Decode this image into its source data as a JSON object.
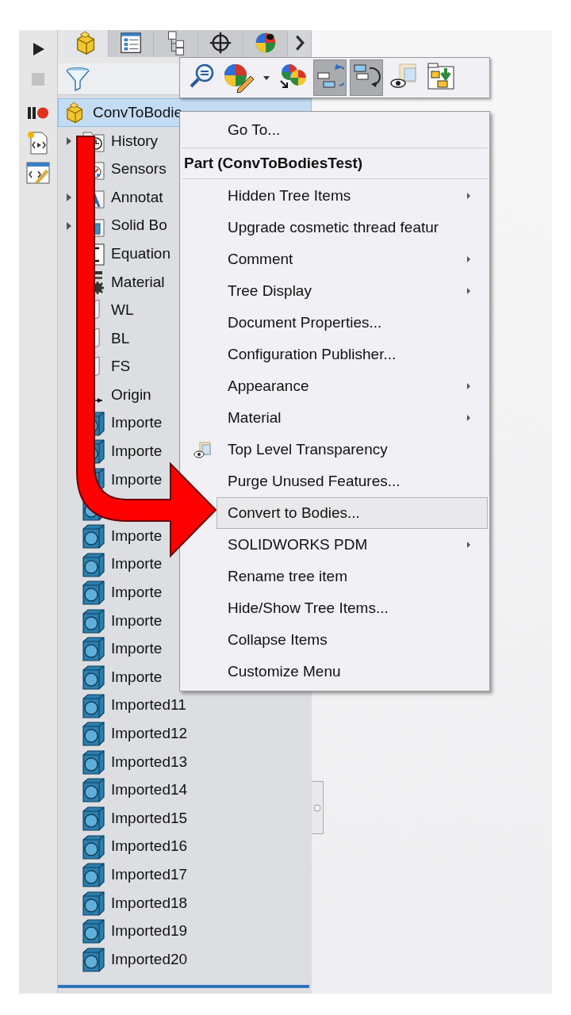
{
  "side_toolbar": [
    {
      "kind": "play",
      "disabled": false
    },
    {
      "kind": "stop",
      "disabled": true
    },
    {
      "kind": "pause_record",
      "disabled": false
    },
    {
      "kind": "macro_file",
      "disabled": false
    },
    {
      "kind": "macro_edit",
      "disabled": false
    }
  ],
  "panel_tabs": [
    {
      "kind": "part",
      "selected": true
    },
    {
      "kind": "properties",
      "selected": false
    },
    {
      "kind": "configurations",
      "selected": false
    },
    {
      "kind": "target",
      "selected": false
    },
    {
      "kind": "appearance",
      "selected": false
    }
  ],
  "tree": {
    "root": {
      "label": "ConvToBodie",
      "selected": true
    },
    "items": [
      {
        "kind": "history",
        "label": "History",
        "expander": true
      },
      {
        "kind": "sensors",
        "label": "Sensors",
        "expander": false
      },
      {
        "kind": "annotations",
        "label": "Annotat",
        "expander": true
      },
      {
        "kind": "solid",
        "label": "Solid Bo",
        "expander": true
      },
      {
        "kind": "equations",
        "label": "Equation",
        "expander": false
      },
      {
        "kind": "material",
        "label": "Material",
        "expander": false
      },
      {
        "kind": "plane",
        "label": "WL",
        "expander": false
      },
      {
        "kind": "plane",
        "label": "BL",
        "expander": false
      },
      {
        "kind": "plane",
        "label": "FS",
        "expander": false
      },
      {
        "kind": "origin",
        "label": "Origin",
        "expander": false
      },
      {
        "kind": "body",
        "label": "Importe",
        "expander": false
      },
      {
        "kind": "body",
        "label": "Importe",
        "expander": false
      },
      {
        "kind": "body",
        "label": "Importe",
        "expander": false
      },
      {
        "kind": "body",
        "expander": false
      },
      {
        "kind": "body",
        "label": "Importe",
        "expander": false
      },
      {
        "kind": "body",
        "label": "Importe",
        "expander": false
      },
      {
        "kind": "body",
        "label": "Importe",
        "expander": false
      },
      {
        "kind": "body",
        "label": "Importe",
        "expander": false
      },
      {
        "kind": "body",
        "label": "Importe",
        "expander": false
      },
      {
        "kind": "body",
        "label": "Importe",
        "expander": false
      },
      {
        "kind": "body",
        "label": "Imported11",
        "expander": false
      },
      {
        "kind": "body",
        "label": "Imported12",
        "expander": false
      },
      {
        "kind": "body",
        "label": "Imported13",
        "expander": false
      },
      {
        "kind": "body",
        "label": "Imported14",
        "expander": false
      },
      {
        "kind": "body",
        "label": "Imported15",
        "expander": false
      },
      {
        "kind": "body",
        "label": "Imported16",
        "expander": false
      },
      {
        "kind": "body",
        "label": "Imported17",
        "expander": false
      },
      {
        "kind": "body",
        "label": "Imported18",
        "expander": false
      },
      {
        "kind": "body",
        "label": "Imported19",
        "expander": false
      },
      {
        "kind": "body",
        "label": "Imported20",
        "expander": false
      }
    ]
  },
  "context_toolbar": {
    "buttons": [
      {
        "kind": "zoom",
        "pressed": false
      },
      {
        "kind": "appearance_edit",
        "pressed": false
      },
      {
        "kind": "dropdown",
        "pressed": false
      },
      {
        "kind": "appearance_copy",
        "pressed": false
      },
      {
        "kind": "tree_rollback",
        "pressed": true
      },
      {
        "kind": "tree_reorder",
        "pressed": true
      },
      {
        "kind": "transparency",
        "pressed": false
      },
      {
        "kind": "folder_swap",
        "pressed": false
      }
    ]
  },
  "context_menu": {
    "items": [
      {
        "kind": "item",
        "label": "Go To...",
        "submenu": false,
        "has_icon": false,
        "selected": false
      },
      {
        "kind": "separator"
      },
      {
        "kind": "header",
        "label": "Part (ConvToBodiesTest)"
      },
      {
        "kind": "separator"
      },
      {
        "kind": "item",
        "label": "Hidden Tree Items",
        "submenu": true,
        "has_icon": false,
        "selected": false
      },
      {
        "kind": "item",
        "label": "Upgrade cosmetic thread featur",
        "submenu": false,
        "has_icon": false,
        "selected": false
      },
      {
        "kind": "item",
        "label": "Comment",
        "submenu": true,
        "has_icon": false,
        "selected": false
      },
      {
        "kind": "item",
        "label": "Tree Display",
        "submenu": true,
        "has_icon": false,
        "selected": false
      },
      {
        "kind": "item",
        "label": "Document Properties...",
        "submenu": false,
        "has_icon": false,
        "selected": false
      },
      {
        "kind": "item",
        "label": "Configuration Publisher...",
        "submenu": false,
        "has_icon": false,
        "selected": false
      },
      {
        "kind": "item",
        "label": "Appearance",
        "submenu": true,
        "has_icon": false,
        "selected": false
      },
      {
        "kind": "item",
        "label": "Material",
        "submenu": true,
        "has_icon": false,
        "selected": false
      },
      {
        "kind": "item",
        "label": "Top Level Transparency",
        "submenu": false,
        "has_icon": true,
        "selected": false
      },
      {
        "kind": "item",
        "label": "Purge Unused Features...",
        "submenu": false,
        "has_icon": false,
        "selected": false
      },
      {
        "kind": "item",
        "label": "Convert to Bodies...",
        "submenu": false,
        "has_icon": false,
        "selected": true
      },
      {
        "kind": "item",
        "label": "SOLIDWORKS PDM",
        "submenu": true,
        "has_icon": false,
        "selected": false
      },
      {
        "kind": "item",
        "label": "Rename tree item",
        "submenu": false,
        "has_icon": false,
        "selected": false
      },
      {
        "kind": "item",
        "label": "Hide/Show Tree Items...",
        "submenu": false,
        "has_icon": false,
        "selected": false
      },
      {
        "kind": "item",
        "label": "Collapse Items",
        "submenu": false,
        "has_icon": false,
        "selected": false
      },
      {
        "kind": "item",
        "label": "Customize Menu",
        "submenu": false,
        "has_icon": false,
        "selected": false
      }
    ]
  }
}
